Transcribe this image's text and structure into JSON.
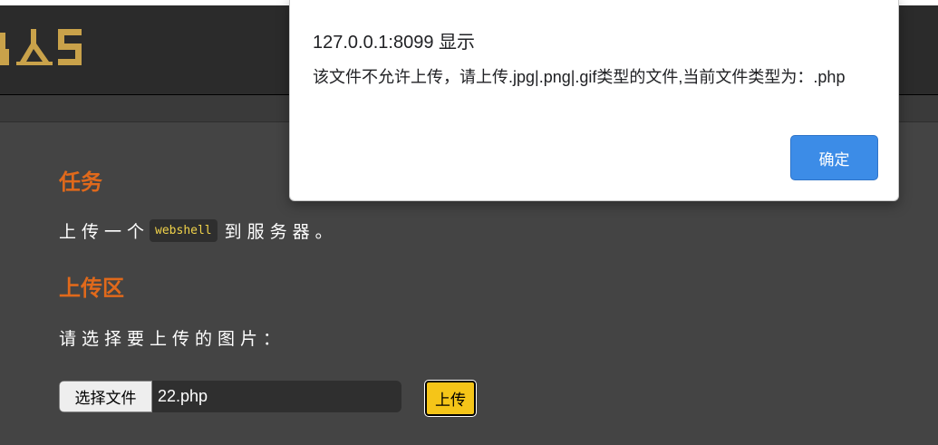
{
  "header": {
    "logo_icon": "app-logo"
  },
  "task": {
    "title": "任务",
    "text_before": "上传一个",
    "code": "webshell",
    "text_after": "到服务器。"
  },
  "upload": {
    "title": "上传区",
    "prompt": "请选择要上传的图片：",
    "choose_file_label": "选择文件",
    "file_name": "22.php",
    "upload_button_label": "上传"
  },
  "dialog": {
    "origin": "127.0.0.1:8099 显示",
    "message": "该文件不允许上传，请上传.jpg|.png|.gif类型的文件,当前文件类型为：.php",
    "ok_label": "确定"
  },
  "colors": {
    "accent_orange": "#e0691b",
    "logo_gold": "#c9a24a",
    "upload_button": "#f5c518",
    "dialog_ok": "#3c8ce7"
  }
}
